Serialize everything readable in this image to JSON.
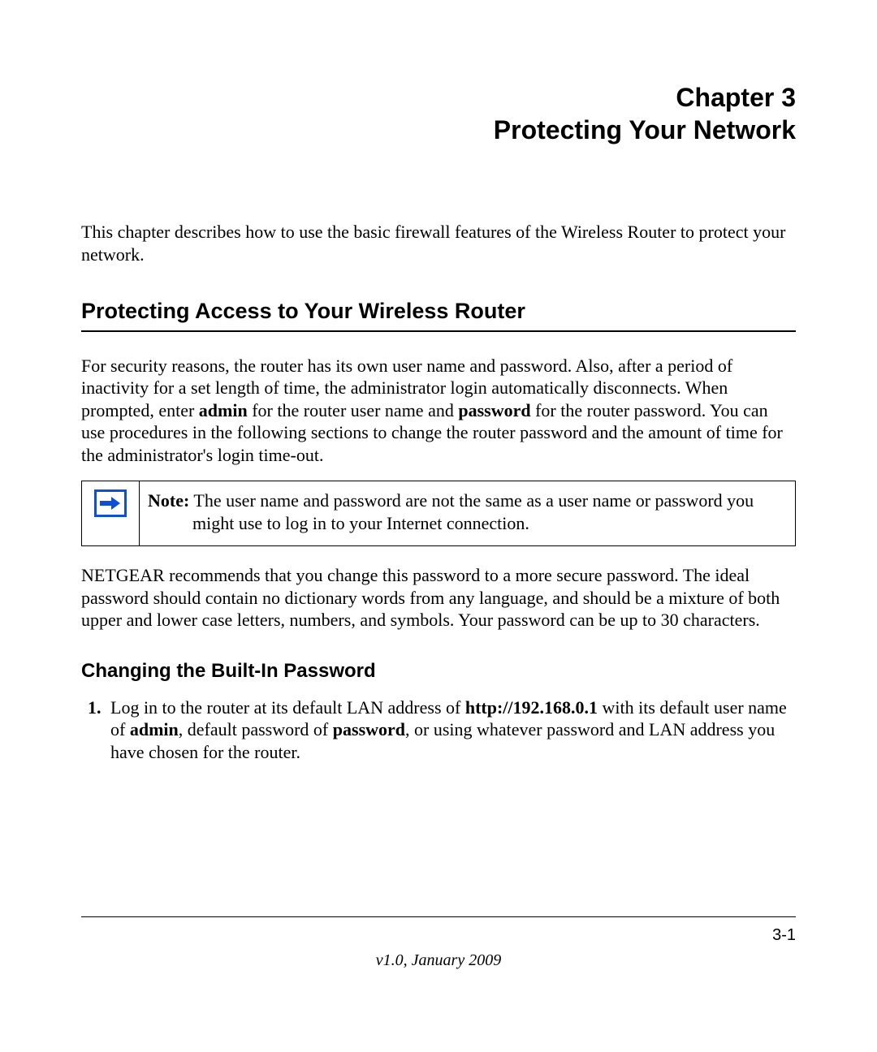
{
  "chapter": {
    "line1": "Chapter 3",
    "line2": "Protecting Your Network"
  },
  "intro": "This chapter describes how to use the basic firewall features of the Wireless Router to protect your network.",
  "section1": {
    "title": "Protecting Access to Your Wireless Router",
    "para1_a": "For security reasons, the router has its own user name and password. Also, after a period of inactivity for a set length of time, the administrator login automatically disconnects. When prompted, enter ",
    "para1_b": "admin",
    "para1_c": " for the router user name and ",
    "para1_d": "password",
    "para1_e": " for the router password. You can use procedures in the following sections to change the router password and the amount of time for the administrator's login time-out.",
    "note_label": "Note:",
    "note_text": " The user name and password are not the same as a user name or password you might use to log in to your Internet connection.",
    "para2": "NETGEAR recommends that you change this password to a more secure password. The ideal password should contain no dictionary words from any language, and should be a mixture of both upper and lower case letters, numbers, and symbols. Your password can be up to 30 characters."
  },
  "section2": {
    "title": "Changing the Built-In Password",
    "step1_a": "Log in to the router at its default LAN address of ",
    "step1_b": "http://192.168.0.1",
    "step1_c": " with its default user name of ",
    "step1_d": "admin",
    "step1_e": ", default password of ",
    "step1_f": "password",
    "step1_g": ", or using whatever password and LAN address you have chosen for the router."
  },
  "footer": {
    "page_number": "3-1",
    "version": "v1.0, January 2009"
  }
}
